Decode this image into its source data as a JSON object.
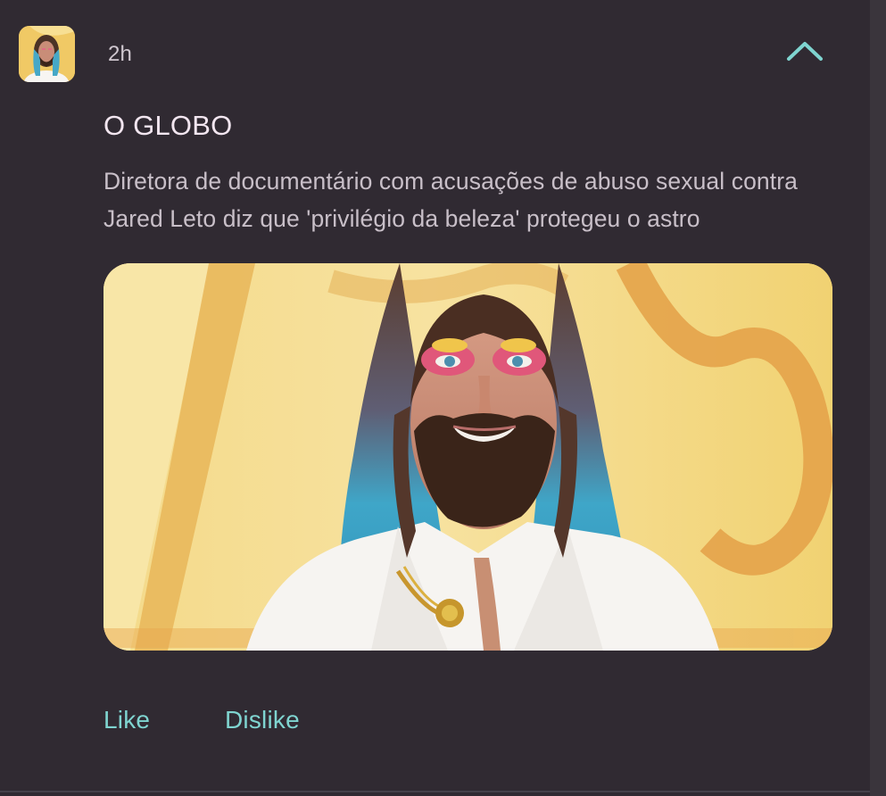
{
  "post": {
    "time": "2h",
    "source": "O GLOBO",
    "headline": "Diretora de documentário com acusações de abuso sexual contra Jared Leto diz que 'privilégio da beleza' protegeu o astro",
    "image_alt": "Jared Leto em evento, com cabelo azul e maquiagem rosa"
  },
  "actions": {
    "like_label": "Like",
    "dislike_label": "Dislike"
  },
  "icons": {
    "collapse": "chevron-up-icon",
    "avatar": "avatar"
  },
  "colors": {
    "background": "#302a32",
    "accent": "#7fd4d0",
    "text_primary": "#f2e6f0",
    "text_secondary": "#c8bfc8"
  }
}
